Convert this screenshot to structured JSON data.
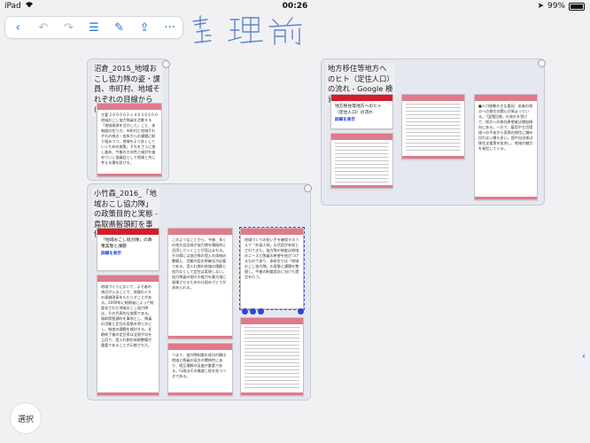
{
  "status_bar": {
    "device": "iPad",
    "time": "00:26",
    "battery": "99%"
  },
  "toolbar": {
    "items": [
      {
        "icon": "back-icon",
        "glyph": "‹"
      },
      {
        "icon": "undo-icon",
        "glyph": "↶"
      },
      {
        "icon": "redo-icon",
        "glyph": "↷"
      },
      {
        "icon": "list-icon",
        "glyph": "☰"
      },
      {
        "icon": "edit-icon",
        "glyph": "✎"
      },
      {
        "icon": "share-icon",
        "glyph": "⇪"
      },
      {
        "icon": "more-icon",
        "glyph": "···"
      }
    ]
  },
  "handwriting": "整理前",
  "groups": [
    {
      "title": "沼倉_2015_地域おこし協力隊の姿・課員、市町村、地域それぞれの目線から(下)"
    },
    {
      "title": "小竹森_2016_「地域おこし協力隊」の政策目的と実態 - 鳥取県智頭町を事例に"
    },
    {
      "title": "地方移住等地方へのヒト（定住人口）の流れ - Google 検索"
    }
  ],
  "cards": {
    "g1c1": {
      "text": "主要 2 0 0 0 0 3 × 4 0 3 0 0 0 0 地域おこし協力隊員を活動する「地域資源を活かした」こと、本制度の在り方、市町村と地域それぞれの視点・各所からの課題に取り組みつつ、地域をより良くしていくための施策。それをさらに推し進め、今後の方向性と検討を進めていく協議会として地域と共に考える場を設ける。"
    },
    "g2c1": {
      "title": "「地域おこし協力隊」の政策実態と課題",
      "link": "詳細を表示"
    },
    "g2c2": {
      "text": "地域づくりにおいて、よそ者の視点が入ることで、地域の人々の意識改革をもたらすことがある。2009年に総務省によって制度化された地域おこし協力隊は、その代表的な施策である。鳥取県智頭町を事例とし、隊員の活動と定住の実態を明らかにし、制度の課題を検討する。任期終了後の定住率は全国平均を上回り、受入れ側の体制整備が重要であることが示唆された。"
    },
    "g2c3": {
      "text": "このようなことから、今後、多くの地方自治体が協力隊を積極的に活用していくことが見込まれる。その際には協力隊の受入れ体制の整備と、活動内容の明確化が必要である。受入れ側の地域の理解と協力なくして定住は実現しない。協力隊員の個々の能力を最大限に発揮させるための仕組みづくりが求められる。"
    },
    "g2c4": {
      "text": "つまり、協力隊制度の成功の鍵は地域と隊員の双方の関係性にあり、相互理解の促進が重要である。行政はその橋渡し役を担うべきである。"
    },
    "g2c5": {
      "text": "地域づくりの担い手を確保するうえで「外部人材」の活用が有効とされてきた。協力隊の制度は地域のニーズと隊員の希望を結びつけるものであり、本研究では「地域おこし協力隊」の実態と課題を整理し、今後の制度設計に向けた提言を行う。"
    },
    "g3c1": {
      "title": "地方移住等地方へのヒト（定住人口）の流れ",
      "link": "詳細を表示"
    },
    "g3c3": {
      "text": "■人口移動の主な要因：若者の地方への移住の関心が高まっている。「田園回帰」の流れを受けて、地方への移住希望者は増加傾向にある。一方で、雇用や生活環境への不安から実際の移住に踏み切れない層も多い。国や自治体は移住支援策を拡充し、地域の魅力を発信している。"
    }
  },
  "select_button": "選択"
}
